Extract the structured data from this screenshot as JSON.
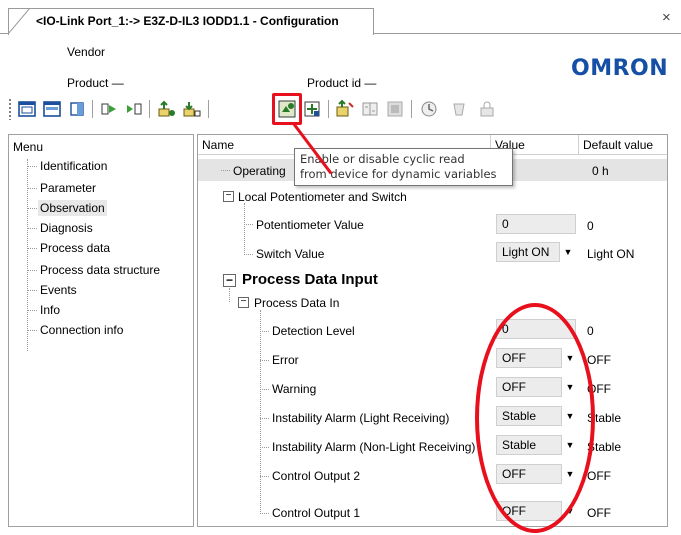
{
  "tab": {
    "title": "<IO-Link Port_1:-> E3Z-D-IL3 IODD1.1 - Configuration",
    "close_glyph": "×"
  },
  "header": {
    "vendor_label": "Vendor",
    "product_label": "Product  —",
    "product_id_label": "Product id  —",
    "logo_text": "OMRON"
  },
  "toolbar": {
    "buttons": [
      {
        "icon": "window-layout-icon"
      },
      {
        "icon": "window-layout-alt-icon"
      },
      {
        "icon": "panel-icon"
      },
      {
        "icon": "device-connect-icon"
      },
      {
        "icon": "device-disconnect-icon"
      },
      {
        "icon": "upload-icon"
      },
      {
        "icon": "download-icon"
      },
      {
        "icon": "cyclic-read-icon"
      },
      {
        "icon": "read-device-icon"
      },
      {
        "icon": "write-device-icon"
      },
      {
        "icon": "compare-icon"
      },
      {
        "icon": "report-icon"
      },
      {
        "icon": "diagnostic-icon"
      },
      {
        "icon": "reset-icon"
      },
      {
        "icon": "lock-icon"
      }
    ]
  },
  "menu": {
    "title": "Menu",
    "items": [
      {
        "label": "Identification"
      },
      {
        "label": "Parameter"
      },
      {
        "label": "Observation"
      },
      {
        "label": "Diagnosis"
      },
      {
        "label": "Process data"
      },
      {
        "label": "Process data structure"
      },
      {
        "label": "Events"
      },
      {
        "label": "Info"
      },
      {
        "label": "Connection info"
      }
    ],
    "selected_index": 2
  },
  "grid": {
    "columns": {
      "name": "Name",
      "value": "Value",
      "default": "Default value"
    },
    "operating_row": {
      "label": "Operating",
      "value": "0",
      "default": "0 h"
    },
    "local_group": {
      "label": "Local Potentiometer and Switch"
    },
    "potentiometer": {
      "label": "Potentiometer Value",
      "value": "0",
      "default": "0"
    },
    "switch": {
      "label": "Switch Value",
      "value": "Light ON",
      "default": "Light ON"
    },
    "pdi_section": {
      "label": "Process Data Input"
    },
    "pdi_group": {
      "label": "Process Data In"
    },
    "rows": [
      {
        "label": "Detection Level",
        "value": "0",
        "default": "0",
        "kind": "text"
      },
      {
        "label": "Error",
        "value": "OFF",
        "default": "OFF",
        "kind": "dropdown"
      },
      {
        "label": "Warning",
        "value": "OFF",
        "default": "OFF",
        "kind": "dropdown"
      },
      {
        "label": "Instability Alarm (Light Receiving)",
        "value": "Stable",
        "default": "Stable",
        "kind": "dropdown"
      },
      {
        "label": "Instability Alarm (Non-Light Receiving)",
        "value": "Stable",
        "default": "Stable",
        "kind": "dropdown"
      },
      {
        "label": "Control Output 2",
        "value": "OFF",
        "default": "OFF",
        "kind": "dropdown"
      },
      {
        "label": "Control Output 1",
        "value": "OFF",
        "default": "OFF",
        "kind": "dropdown"
      }
    ]
  },
  "tooltip": {
    "line1": "Enable or disable cyclic read",
    "line2": "from device for dynamic variables"
  },
  "colors": {
    "annotation_red": "#e8101c",
    "logo_blue": "#1650a6",
    "field_gray": "#ececec"
  }
}
